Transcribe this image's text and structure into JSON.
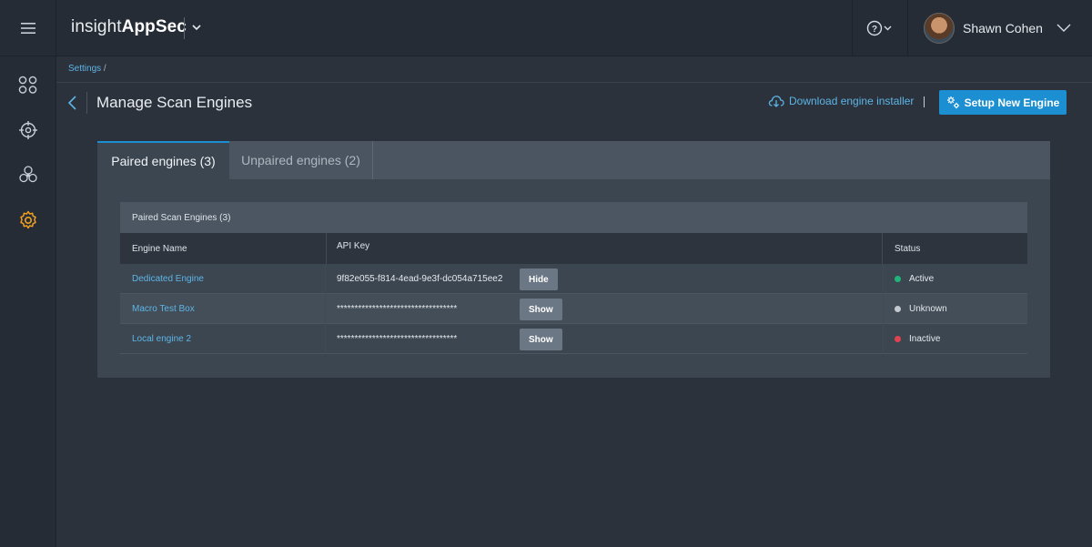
{
  "topbar": {
    "brand_light": "insight",
    "brand_bold": "AppSec",
    "user_name": "Shawn Cohen"
  },
  "breadcrumb": {
    "link": "Settings",
    "separator": " /"
  },
  "header": {
    "title": "Manage Scan Engines",
    "download_label": "Download engine installer",
    "setup_label": "Setup New Engine"
  },
  "tabs": [
    {
      "label": "Paired engines (3)",
      "active": true
    },
    {
      "label": "Unpaired engines (2)",
      "active": false
    }
  ],
  "table": {
    "title": "Paired Scan Engines (3)",
    "columns": [
      "Engine Name",
      "API Key",
      "Status"
    ],
    "rows": [
      {
        "name": "Dedicated Engine",
        "api_key": "9f82e055-f814-4ead-9e3f-dc054a715ee2",
        "button": "Hide",
        "status": "Active",
        "status_color": "#1fb57a"
      },
      {
        "name": "Macro Test Box",
        "api_key": "**********************************",
        "button": "Show",
        "status": "Unknown",
        "status_color": "#c3c9cf"
      },
      {
        "name": "Local engine 2",
        "api_key": "**********************************",
        "button": "Show",
        "status": "Inactive",
        "status_color": "#e0434f"
      }
    ]
  },
  "colors": {
    "accent": "#1b8fd2",
    "link": "#5db5e6",
    "settings_active": "#f0a020"
  },
  "icons": {
    "menu": "hamburger-icon",
    "help": "help-circle-icon",
    "sidebar": [
      "apps-grid-icon",
      "target-icon",
      "biohazard-icon",
      "gear-icon"
    ]
  }
}
